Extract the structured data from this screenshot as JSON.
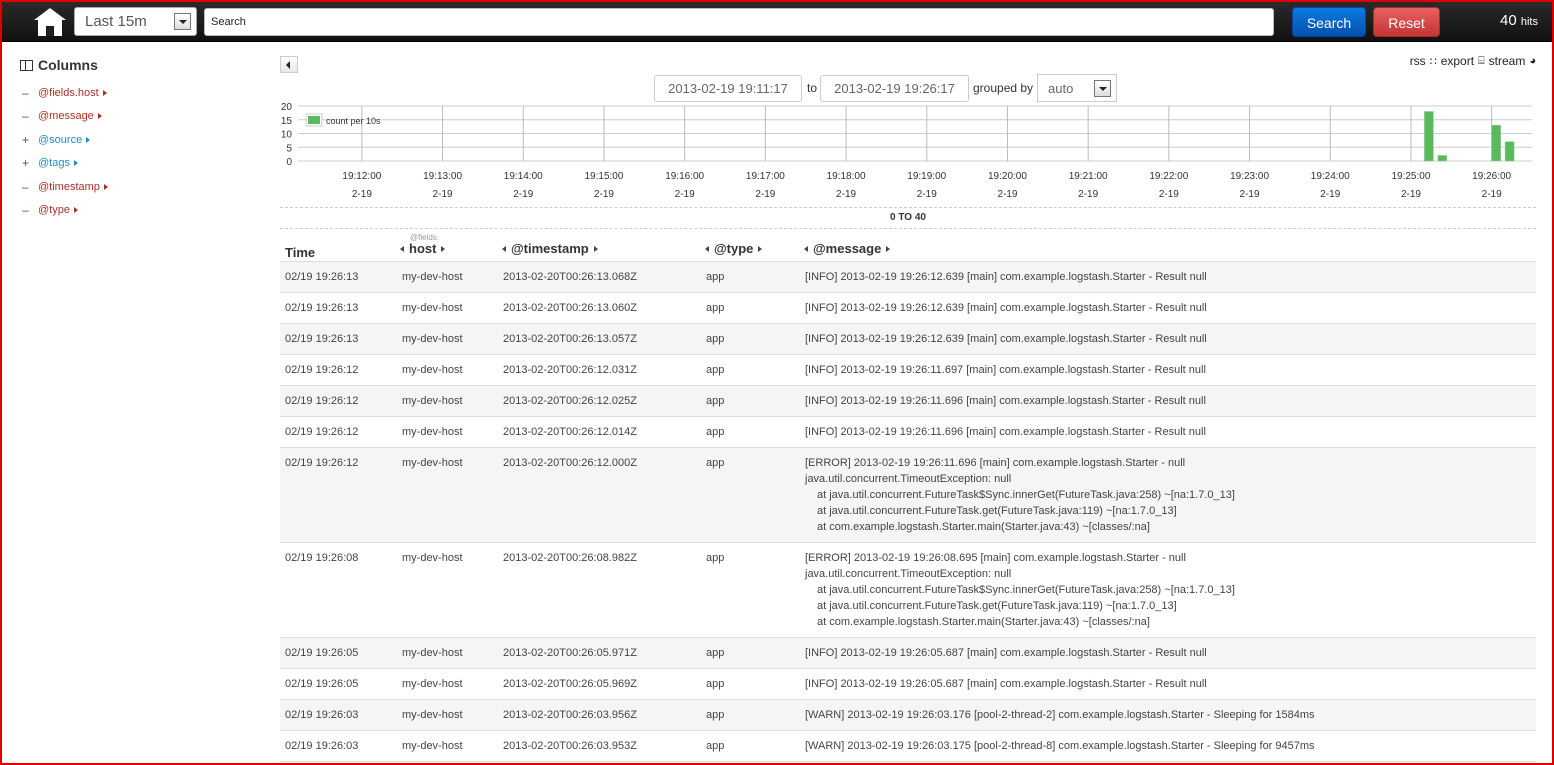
{
  "topbar": {
    "home_icon": "home-icon",
    "time_range": "Last 15m",
    "search_placeholder": "Search",
    "search_value": "",
    "search_label": "Search",
    "reset_label": "Reset",
    "hits_count": "40",
    "hits_label": "hits"
  },
  "sidebar": {
    "title": "Columns",
    "fields": [
      {
        "name": "@fields.host",
        "selected": true,
        "toggle": "–"
      },
      {
        "name": "@message",
        "selected": true,
        "toggle": "–"
      },
      {
        "name": "@source",
        "selected": false,
        "toggle": "+"
      },
      {
        "name": "@tags",
        "selected": false,
        "toggle": "+"
      },
      {
        "name": "@timestamp",
        "selected": true,
        "toggle": "–"
      },
      {
        "name": "@type",
        "selected": true,
        "toggle": "–"
      }
    ]
  },
  "header_links": {
    "rss": "rss",
    "export": "export",
    "stream": "stream"
  },
  "range": {
    "from": "2013-02-19 19:11:17",
    "to_label": "to",
    "to": "2013-02-19 19:26:17",
    "grouped_by_label": "grouped by",
    "interval": "auto"
  },
  "chart_data": {
    "type": "bar",
    "legend": "count per 10s",
    "legend_position": "top-left",
    "ylim": [
      0,
      20
    ],
    "yticks": [
      0,
      5,
      10,
      15,
      20
    ],
    "x_range": [
      "19:11:17",
      "19:26:17"
    ],
    "xticks": [
      "19:12:00",
      "19:13:00",
      "19:14:00",
      "19:15:00",
      "19:16:00",
      "19:17:00",
      "19:18:00",
      "19:19:00",
      "19:20:00",
      "19:21:00",
      "19:22:00",
      "19:23:00",
      "19:24:00",
      "19:25:00",
      "19:26:00"
    ],
    "xtick_date": "2-19",
    "bars": [
      {
        "t": "19:25:10",
        "value": 18
      },
      {
        "t": "19:25:20",
        "value": 2
      },
      {
        "t": "19:26:00",
        "value": 13
      },
      {
        "t": "19:26:10",
        "value": 7
      }
    ],
    "grid": true
  },
  "pager": "0 TO 40",
  "table": {
    "columns": [
      {
        "label": "Time",
        "super": ""
      },
      {
        "label": "host",
        "super": "@fields."
      },
      {
        "label": "@timestamp",
        "super": ""
      },
      {
        "label": "@type",
        "super": ""
      },
      {
        "label": "@message",
        "super": ""
      }
    ],
    "rows": [
      {
        "time": "02/19 19:26:13",
        "host": "my-dev-host",
        "ts": "2013-02-20T00:26:13.068Z",
        "type": "app",
        "msg": [
          "[INFO] 2013-02-19 19:26:12.639 [main] com.example.logstash.Starter - Result null"
        ]
      },
      {
        "time": "02/19 19:26:13",
        "host": "my-dev-host",
        "ts": "2013-02-20T00:26:13.060Z",
        "type": "app",
        "msg": [
          "[INFO] 2013-02-19 19:26:12.639 [main] com.example.logstash.Starter - Result null"
        ]
      },
      {
        "time": "02/19 19:26:13",
        "host": "my-dev-host",
        "ts": "2013-02-20T00:26:13.057Z",
        "type": "app",
        "msg": [
          "[INFO] 2013-02-19 19:26:12.639 [main] com.example.logstash.Starter - Result null"
        ]
      },
      {
        "time": "02/19 19:26:12",
        "host": "my-dev-host",
        "ts": "2013-02-20T00:26:12.031Z",
        "type": "app",
        "msg": [
          "[INFO] 2013-02-19 19:26:11.697 [main] com.example.logstash.Starter - Result null"
        ]
      },
      {
        "time": "02/19 19:26:12",
        "host": "my-dev-host",
        "ts": "2013-02-20T00:26:12.025Z",
        "type": "app",
        "msg": [
          "[INFO] 2013-02-19 19:26:11.696 [main] com.example.logstash.Starter - Result null"
        ]
      },
      {
        "time": "02/19 19:26:12",
        "host": "my-dev-host",
        "ts": "2013-02-20T00:26:12.014Z",
        "type": "app",
        "msg": [
          "[INFO] 2013-02-19 19:26:11.696 [main] com.example.logstash.Starter - Result null"
        ]
      },
      {
        "time": "02/19 19:26:12",
        "host": "my-dev-host",
        "ts": "2013-02-20T00:26:12.000Z",
        "type": "app",
        "msg": [
          "[ERROR] 2013-02-19 19:26:11.696 [main] com.example.logstash.Starter - null",
          "java.util.concurrent.TimeoutException: null",
          "at java.util.concurrent.FutureTask$Sync.innerGet(FutureTask.java:258) ~[na:1.7.0_13]",
          "at java.util.concurrent.FutureTask.get(FutureTask.java:119) ~[na:1.7.0_13]",
          "at com.example.logstash.Starter.main(Starter.java:43) ~[classes/:na]"
        ]
      },
      {
        "time": "02/19 19:26:08",
        "host": "my-dev-host",
        "ts": "2013-02-20T00:26:08.982Z",
        "type": "app",
        "msg": [
          "[ERROR] 2013-02-19 19:26:08.695 [main] com.example.logstash.Starter - null",
          "java.util.concurrent.TimeoutException: null",
          "at java.util.concurrent.FutureTask$Sync.innerGet(FutureTask.java:258) ~[na:1.7.0_13]",
          "at java.util.concurrent.FutureTask.get(FutureTask.java:119) ~[na:1.7.0_13]",
          "at com.example.logstash.Starter.main(Starter.java:43) ~[classes/:na]"
        ]
      },
      {
        "time": "02/19 19:26:05",
        "host": "my-dev-host",
        "ts": "2013-02-20T00:26:05.971Z",
        "type": "app",
        "msg": [
          "[INFO] 2013-02-19 19:26:05.687 [main] com.example.logstash.Starter - Result null"
        ]
      },
      {
        "time": "02/19 19:26:05",
        "host": "my-dev-host",
        "ts": "2013-02-20T00:26:05.969Z",
        "type": "app",
        "msg": [
          "[INFO] 2013-02-19 19:26:05.687 [main] com.example.logstash.Starter - Result null"
        ]
      },
      {
        "time": "02/19 19:26:03",
        "host": "my-dev-host",
        "ts": "2013-02-20T00:26:03.956Z",
        "type": "app",
        "msg": [
          "[WARN] 2013-02-19 19:26:03.176 [pool-2-thread-2] com.example.logstash.Starter - Sleeping for 1584ms"
        ]
      },
      {
        "time": "02/19 19:26:03",
        "host": "my-dev-host",
        "ts": "2013-02-20T00:26:03.953Z",
        "type": "app",
        "msg": [
          "[WARN] 2013-02-19 19:26:03.175 [pool-2-thread-8] com.example.logstash.Starter - Sleeping for 9457ms"
        ]
      }
    ]
  },
  "colors": {
    "bar": "#5cb85c",
    "selected_field": "#a93226",
    "unselected_field": "#1f8dc8",
    "search_button": "#0a6fd6",
    "reset_button": "#d54848"
  }
}
